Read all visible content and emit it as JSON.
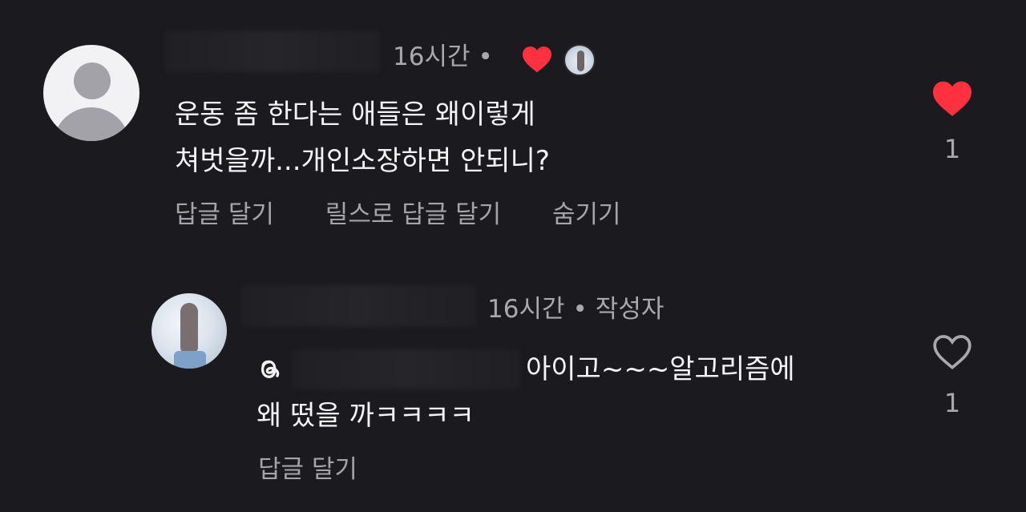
{
  "comment": {
    "time": "16시간",
    "separator": "•",
    "text_line1": "운동 좀 한다는 애들은 왜이렇게",
    "text_line2": "쳐벗을까...개인소장하면 안되니?",
    "actions": [
      "답글 달기",
      "릴스로 답글 달기",
      "숨기기"
    ],
    "like_count": "1",
    "liked": true
  },
  "reply": {
    "time": "16시간",
    "separator": "•",
    "author_badge": "작성자",
    "text_line1": "아이고~~~알고리즘에",
    "text_line2": "왜 떴을 까ㅋㅋㅋㅋ",
    "actions": [
      "답글 달기"
    ],
    "like_count": "1",
    "liked": false
  },
  "colors": {
    "background": "#1b1b1f",
    "heart_red": "#ff3040",
    "secondary_text": "#a8a8ae"
  },
  "icons": {
    "comment_like": "heart-filled-icon",
    "reply_like": "heart-outline-icon",
    "author_liked": "heart-filled-icon",
    "threads": "threads-icon"
  }
}
